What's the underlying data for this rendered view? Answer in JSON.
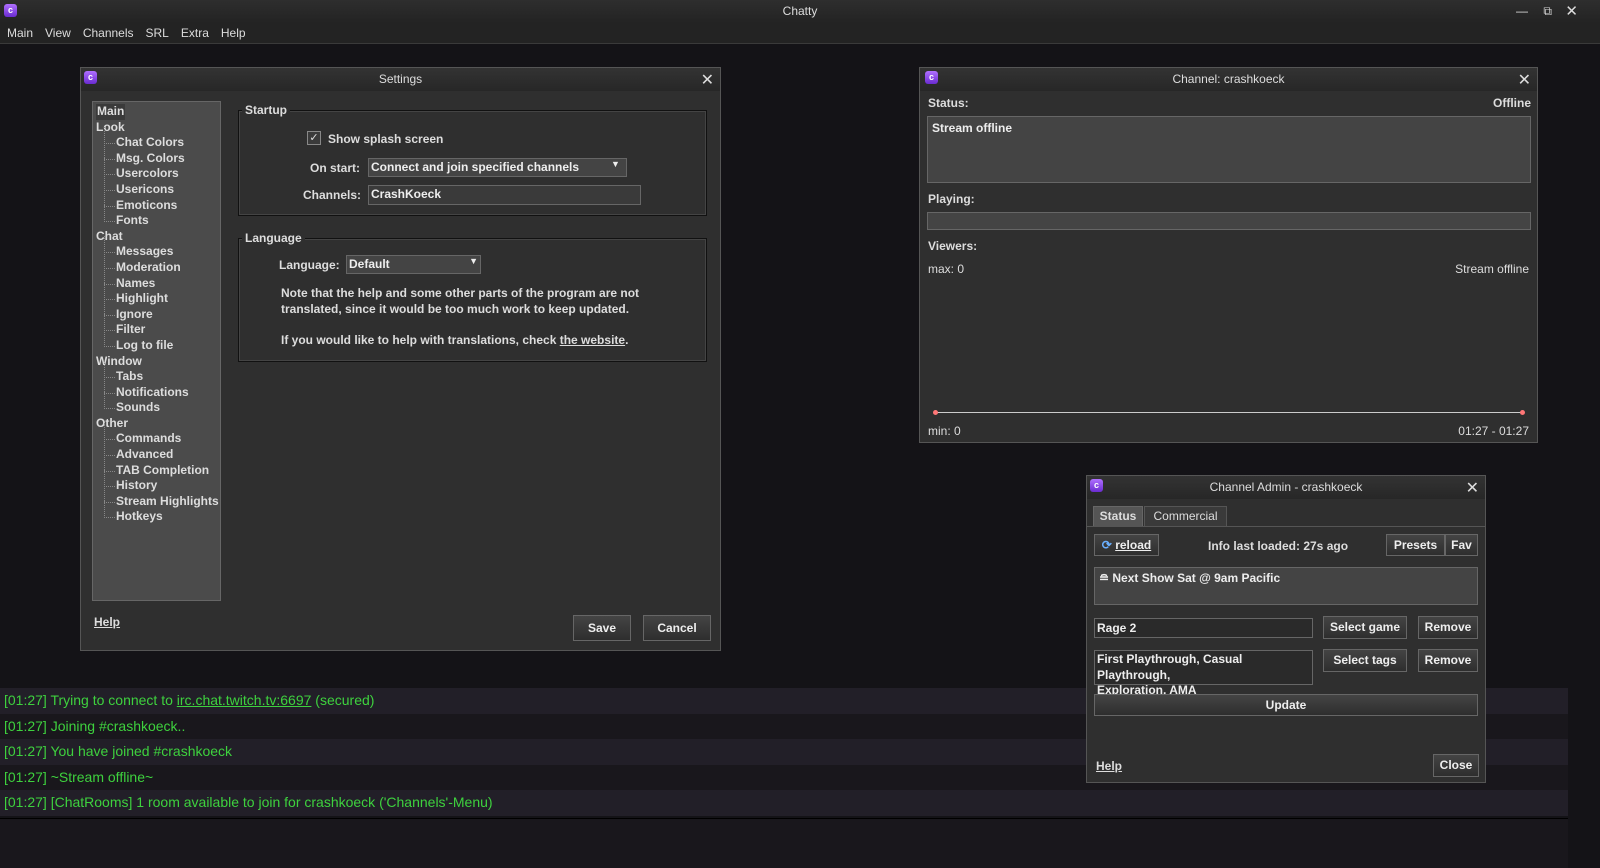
{
  "app": {
    "title": "Chatty",
    "menu": [
      "Main",
      "View",
      "Channels",
      "SRL",
      "Extra",
      "Help"
    ]
  },
  "settings": {
    "title": "Settings",
    "tree": [
      {
        "l": "Main",
        "c": false
      },
      {
        "l": "Look",
        "c": false
      },
      {
        "l": "Chat Colors",
        "c": true
      },
      {
        "l": "Msg. Colors",
        "c": true
      },
      {
        "l": "Usercolors",
        "c": true
      },
      {
        "l": "Usericons",
        "c": true
      },
      {
        "l": "Emoticons",
        "c": true
      },
      {
        "l": "Fonts",
        "c": true
      },
      {
        "l": "Chat",
        "c": false
      },
      {
        "l": "Messages",
        "c": true
      },
      {
        "l": "Moderation",
        "c": true
      },
      {
        "l": "Names",
        "c": true
      },
      {
        "l": "Highlight",
        "c": true
      },
      {
        "l": "Ignore",
        "c": true
      },
      {
        "l": "Filter",
        "c": true
      },
      {
        "l": "Log to file",
        "c": true
      },
      {
        "l": "Window",
        "c": false
      },
      {
        "l": "Tabs",
        "c": true
      },
      {
        "l": "Notifications",
        "c": true
      },
      {
        "l": "Sounds",
        "c": true
      },
      {
        "l": "Other",
        "c": false
      },
      {
        "l": "Commands",
        "c": true
      },
      {
        "l": "Advanced",
        "c": true
      },
      {
        "l": "TAB Completion",
        "c": true
      },
      {
        "l": "History",
        "c": true
      },
      {
        "l": "Stream Highlights",
        "c": true
      },
      {
        "l": "Hotkeys",
        "c": true
      }
    ],
    "startup": {
      "label": "Startup",
      "splash": "Show splash screen",
      "splash_checked": true,
      "on_start_label": "On start:",
      "on_start": "Connect and join specified channels",
      "channels_label": "Channels:",
      "channels": "CrashKoeck"
    },
    "language": {
      "label": "Language",
      "lang_label": "Language:",
      "lang": "Default",
      "note1": "Note that the help and some other parts of the program are not",
      "note2": "translated, since it would be too much work to keep updated.",
      "note3": "If you would like to help with translations, check",
      "link": "the website",
      "dot": "."
    },
    "help": "Help",
    "save": "Save",
    "cancel": "Cancel"
  },
  "channel": {
    "title": "Channel: crashkoeck",
    "status_label": "Status:",
    "status_value": "Offline",
    "status_text": "Stream offline",
    "playing_label": "Playing:",
    "viewers_label": "Viewers:",
    "max": "max: 0",
    "graph_status": "Stream offline",
    "min": "min: 0",
    "range": "01:27 - 01:27"
  },
  "admin": {
    "title": "Channel Admin - crashkoeck",
    "tabs": [
      "Status",
      "Commercial"
    ],
    "reload": "reload",
    "info": "Info last loaded: 27s ago",
    "presets": "Presets",
    "fav": "Fav",
    "status_text": "≘ Next Show Sat @ 9am Pacific",
    "game": "Rage 2",
    "select_game": "Select game",
    "remove": "Remove",
    "tags1": "First Playthrough, Casual Playthrough,",
    "tags2": "Exploration, AMA",
    "select_tags": "Select tags",
    "update": "Update",
    "help": "Help",
    "close": "Close"
  },
  "chat": {
    "pre": "[01:27] Trying to connect to ",
    "link": "irc.chat.twitch.tv:6697",
    "post": " (secured)",
    "lines": [
      "[01:27] Joining #crashkoeck..",
      "[01:27] You have joined #crashkoeck",
      "[01:27] ~Stream offline~",
      "[01:27] [ChatRooms] 1 room available to join for crashkoeck ('Channels'-Menu)"
    ],
    "color": "#3ed13e"
  }
}
